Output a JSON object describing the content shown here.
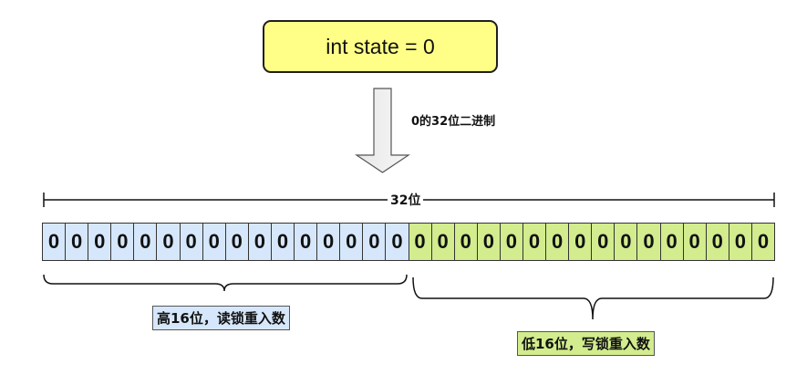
{
  "state_box": {
    "text": "int state = 0",
    "fill": "#ffff88"
  },
  "arrow": {
    "label": "0的32位二进制"
  },
  "span": {
    "label": "32位"
  },
  "bits": {
    "high": [
      "0",
      "0",
      "0",
      "0",
      "0",
      "0",
      "0",
      "0",
      "0",
      "0",
      "0",
      "0",
      "0",
      "0",
      "0",
      "0"
    ],
    "low": [
      "0",
      "0",
      "0",
      "0",
      "0",
      "0",
      "0",
      "0",
      "0",
      "0",
      "0",
      "0",
      "0",
      "0",
      "0",
      "0"
    ],
    "high_color": "#d6e7fb",
    "low_color": "#d2ec8e"
  },
  "labels": {
    "high": "高16位，读锁重入数",
    "low": "低16位，写锁重入数"
  }
}
